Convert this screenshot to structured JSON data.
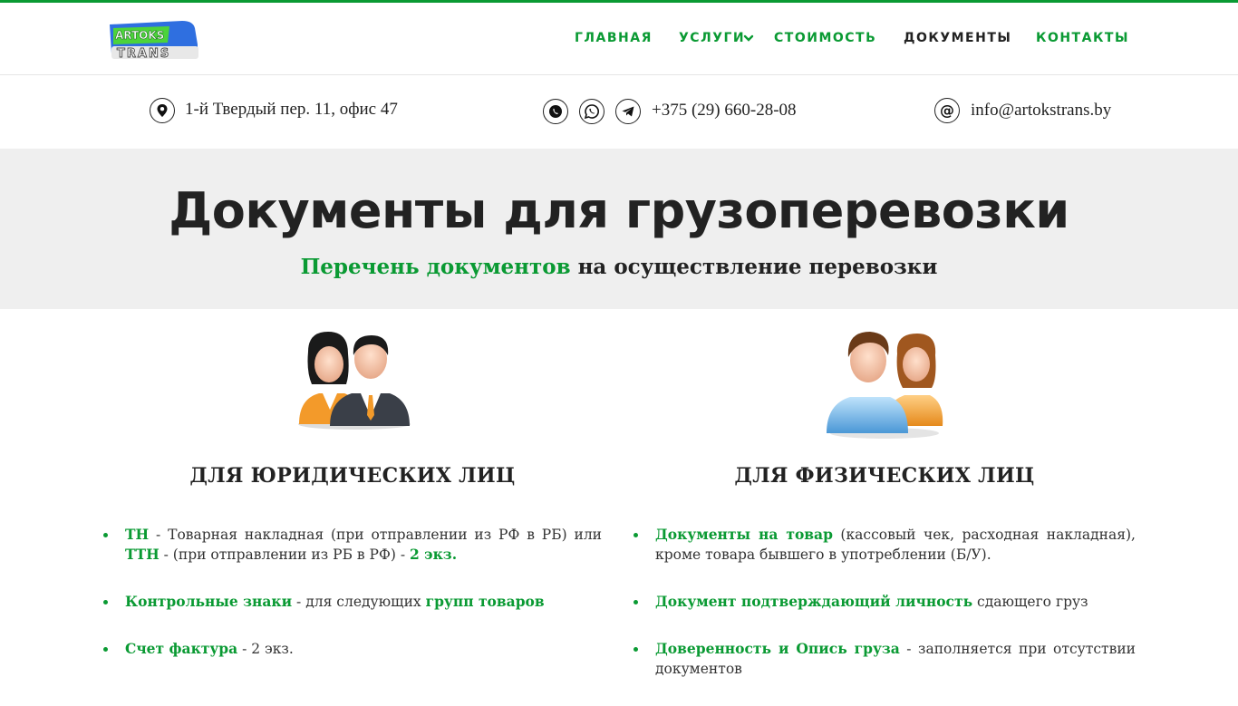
{
  "brand": {
    "logo_line1": "ARTOKS",
    "logo_line2": "TRANS"
  },
  "nav": {
    "items": [
      {
        "label": "ГЛАВНАЯ"
      },
      {
        "label": "УСЛУГИ"
      },
      {
        "label": "СТОИМОСТЬ"
      },
      {
        "label": "ДОКУМЕНТЫ"
      },
      {
        "label": "КОНТАКТЫ"
      }
    ]
  },
  "contacts": {
    "address": "1-й Твердый пер. 11, офис 47",
    "phone": "+375 (29) 660-28-08",
    "email": "info@artokstrans.by"
  },
  "hero": {
    "title": "Документы для грузоперевозки",
    "subtitle_green": "Перечень документов",
    "subtitle_rest": " на осуществление перевозки"
  },
  "legal": {
    "title": "ДЛЯ ЮРИДИЧЕСКИХ ЛИЦ",
    "items": [
      {
        "p1": "ТН",
        "t1": " - Товарная накладная (при отправлении из РФ в РБ) или ",
        "p2": "ТТН",
        "t2": " -  (при отправлении из РБ в РФ) - ",
        "p3": "2 экз."
      },
      {
        "p1": "Контрольные знаки",
        "t1": "  - для следующих ",
        "p2": "групп товаров"
      },
      {
        "p1": "Счет фактура",
        "t1": "  - 2 экз."
      }
    ]
  },
  "individual": {
    "title": "ДЛЯ ФИЗИЧЕСКИХ ЛИЦ",
    "items": [
      {
        "p1": "Документы на товар",
        "t1": " (кассовый чек, расходная накладная), кроме  товара бывшего в употреблении (Б/У)."
      },
      {
        "p1": "Документ подтверждающий личность",
        "t1": " сдающего груз"
      },
      {
        "p1": "Доверенность и Опись груза",
        "t1": " - заполняется при отсутствии документов"
      }
    ]
  },
  "colors": {
    "accent": "#0a9a33",
    "hero_bg": "#efefef",
    "text": "#222222"
  }
}
